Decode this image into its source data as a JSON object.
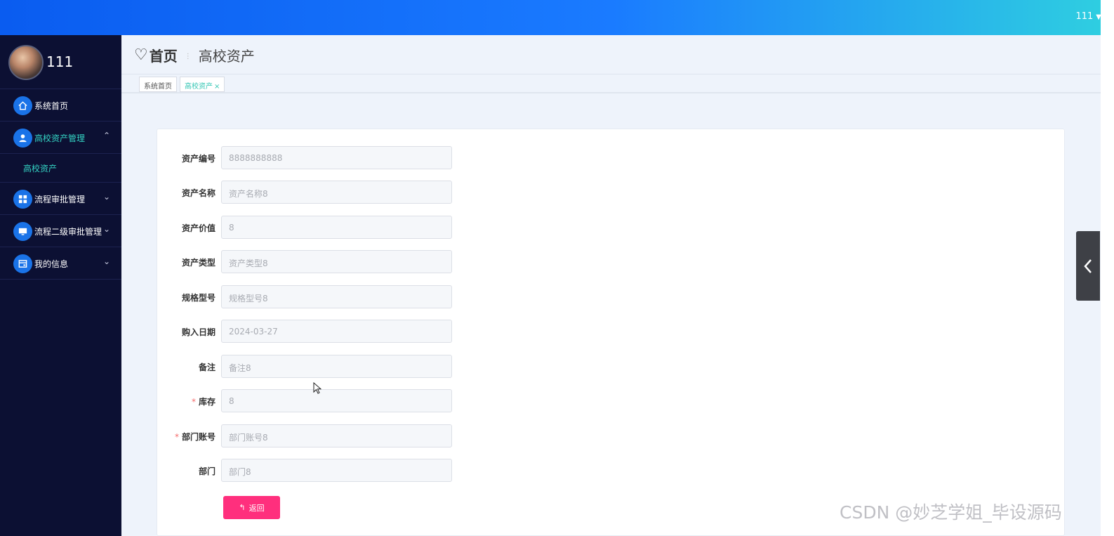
{
  "topbar": {
    "username": "111",
    "caret": "▼"
  },
  "sidebar": {
    "profile_name": "111",
    "items": [
      {
        "label": "系统首页",
        "icon": "home-icon",
        "chevron": ""
      },
      {
        "label": "高校资产管理",
        "icon": "user-icon",
        "chevron": "⌃"
      },
      {
        "label": "流程审批管理",
        "icon": "grid-icon",
        "chevron": "⌄"
      },
      {
        "label": "流程二级审批管理",
        "icon": "monitor-icon",
        "chevron": "⌄"
      },
      {
        "label": "我的信息",
        "icon": "card-icon",
        "chevron": "⌄"
      }
    ],
    "submenu": {
      "label": "高校资产"
    }
  },
  "header": {
    "home": "首页",
    "current": "高校资产",
    "separator": "⋮"
  },
  "tabs": [
    {
      "label": "系统首页"
    },
    {
      "label": "高校资产",
      "close": "×"
    }
  ],
  "form": {
    "fields": [
      {
        "label": "资产编号",
        "required": false,
        "value": "8888888888"
      },
      {
        "label": "资产名称",
        "required": false,
        "value": "资产名称8"
      },
      {
        "label": "资产价值",
        "required": false,
        "value": "8"
      },
      {
        "label": "资产类型",
        "required": false,
        "value": "资产类型8"
      },
      {
        "label": "规格型号",
        "required": false,
        "value": "规格型号8"
      },
      {
        "label": "购入日期",
        "required": false,
        "value": "2024-03-27"
      },
      {
        "label": "备注",
        "required": false,
        "value": "备注8"
      },
      {
        "label": "库存",
        "required": true,
        "value": "8"
      },
      {
        "label": "部门账号",
        "required": true,
        "value": "部门账号8"
      },
      {
        "label": "部门",
        "required": false,
        "value": "部门8"
      }
    ],
    "required_mark": "*",
    "back_button": {
      "label": "返回",
      "arrow": "↰"
    }
  },
  "watermark": "CSDN @妙芝学姐_毕设源码",
  "colors": {
    "accent": "#1a73e8",
    "active": "#34d4c4",
    "button": "#ff2f7d",
    "sidebar_bg": "#0c1033"
  }
}
